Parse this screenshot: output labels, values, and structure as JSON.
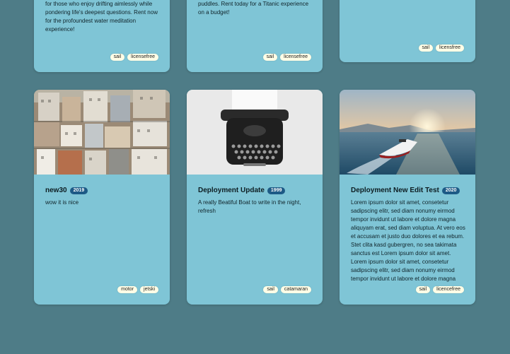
{
  "cards": [
    {
      "text": "for those who enjoy drifting aimlessly while pondering life's deepest questions. Rent now for the profoundest water meditation experience!",
      "tags": [
        "sail",
        "licensefree"
      ]
    },
    {
      "text": "puddles. Rent today for a Titanic experience on a budget!",
      "tags": [
        "sail",
        "licensefree"
      ]
    },
    {
      "text": "",
      "tags": [
        "sail",
        "licensfree"
      ]
    },
    {
      "title": "new30",
      "year": "2019",
      "image": "city-rooftops-photo",
      "text": "wow it is nice",
      "tags": [
        "motor",
        "jetski"
      ]
    },
    {
      "title": "Deployment Update",
      "year": "1999",
      "image": "typewriter-photo",
      "text": "A really Beatiful Boat to write in the night, refresh",
      "tags": [
        "sail",
        "catamaran"
      ]
    },
    {
      "title": "Deployment New Edit Test",
      "year": "2020",
      "image": "speedboat-sunset-photo",
      "text": "Lorem ipsum dolor sit amet, consetetur sadipscing elitr, sed diam nonumy eirmod tempor invidunt ut labore et dolore magna aliquyam erat, sed diam voluptua. At vero eos et accusam et justo duo dolores et ea rebum. Stet clita kasd gubergren, no sea takimata sanctus est Lorem ipsum dolor sit amet. Lorem ipsum dolor sit amet, consetetur sadipscing elitr, sed diam nonumy eirmod tempor invidunt ut labore et dolore magna aliquyam erat, sed diam voluptua.",
      "tags": [
        "sail",
        "licencefree"
      ]
    }
  ]
}
